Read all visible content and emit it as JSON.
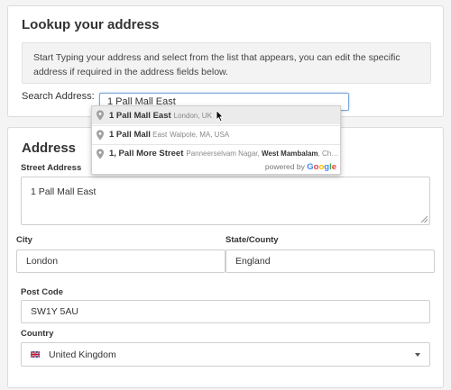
{
  "lookup": {
    "title": "Lookup your address",
    "info": "Start Typing your address and select from the list that appears, you can edit the specific address if required in the address fields below.",
    "search_label": "Search Address:",
    "search_value": "1 Pall Mall East"
  },
  "suggestions": [
    {
      "main_bold": "1 Pall Mall East",
      "main_rest": "",
      "secondary": "London, UK"
    },
    {
      "main_bold": "1 Pall Mall",
      "main_rest": " East",
      "secondary": "Walpole, MA, USA"
    },
    {
      "main_bold": "1, Pall More Street",
      "main_rest": "",
      "secondary_pre": "Panneerselvam Nagar, ",
      "secondary_bold": "West Mambalam",
      "secondary_post": ", Chenn..."
    }
  ],
  "powered_by": "powered by",
  "google_letters": [
    "G",
    "o",
    "o",
    "g",
    "l",
    "e"
  ],
  "google_colors": [
    "#4285F4",
    "#EA4335",
    "#FBBC05",
    "#4285F4",
    "#34A853",
    "#EA4335"
  ],
  "address": {
    "title": "Address",
    "street_label": "Street Address",
    "street_value": "1 Pall Mall East",
    "city_label": "City",
    "city_value": "London",
    "state_label": "State/County",
    "state_value": "England",
    "postcode_label": "Post Code",
    "postcode_value": "SW1Y 5AU",
    "country_label": "Country",
    "country_value": "United Kingdom"
  },
  "icons": {
    "pin": "map-pin-icon",
    "flag": "uk-flag-icon",
    "caret": "chevron-down-icon",
    "cursor": "mouse-cursor-icon"
  },
  "colors": {
    "input_focus_border": "#7aa7d9",
    "card_border": "#dcdcdc",
    "info_bg": "#f3f3f3",
    "highlighted_suggestion_bg": "#ebebeb"
  }
}
